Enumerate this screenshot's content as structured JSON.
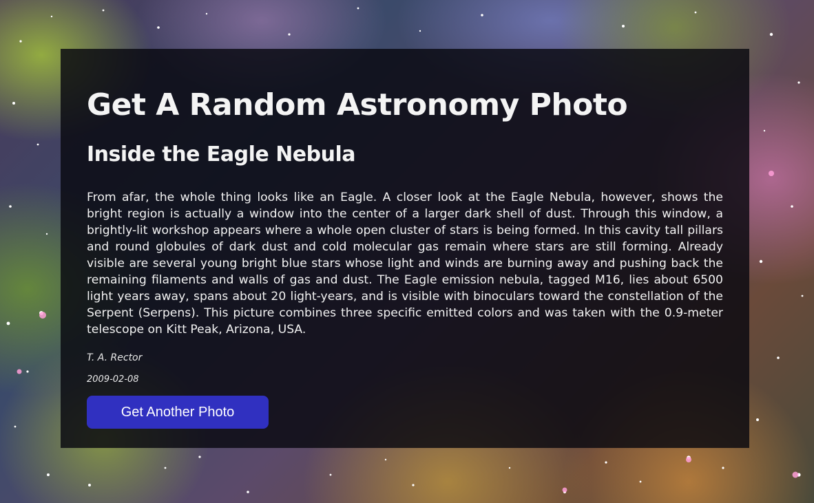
{
  "page": {
    "title": "Get A Random Astronomy Photo"
  },
  "photo": {
    "title": "Inside the Eagle Nebula",
    "explanation": "From afar, the whole thing looks like an Eagle. A closer look at the Eagle Nebula, however, shows the bright region is actually a window into the center of a larger dark shell of dust. Through this window, a brightly-lit workshop appears where a whole open cluster of stars is being formed. In this cavity tall pillars and round globules of dark dust and cold molecular gas remain where stars are still forming. Already visible are several young bright blue stars whose light and winds are burning away and pushing back the remaining filaments and walls of gas and dust. The Eagle emission nebula, tagged M16, lies about 6500 light years away, spans about 20 light-years, and is visible with binoculars toward the constellation of the Serpent (Serpens). This picture combines three specific emitted colors and was taken with the 0.9-meter telescope on Kitt Peak, Arizona, USA.",
    "copyright": "T. A. Rector",
    "date": "2009-02-08"
  },
  "actions": {
    "next_label": "Get Another Photo"
  },
  "colors": {
    "button": "#3030c0",
    "card": "rgba(8,8,16,0.82)"
  }
}
